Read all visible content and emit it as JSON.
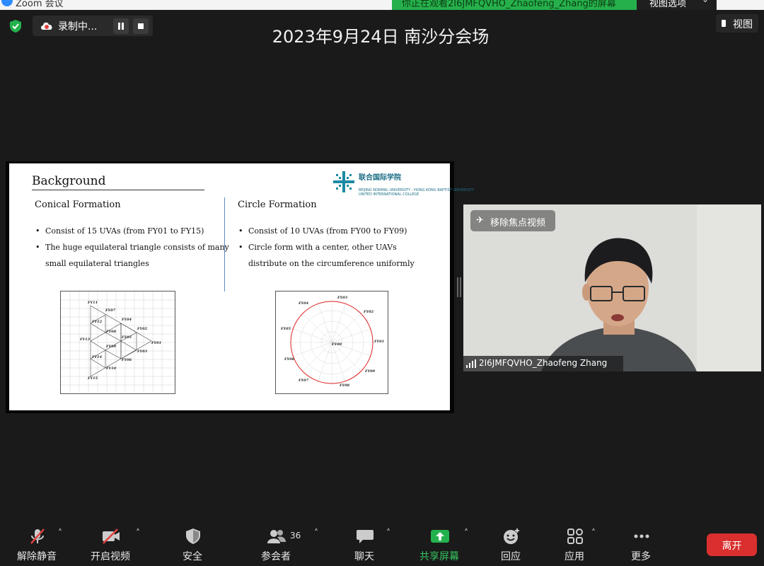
{
  "window": {
    "app_title": "Zoom 会议",
    "share_banner": "你正在观看2I6JMFQVHO_Zhaofeng_Zhang的屏幕",
    "view_options": "视图选项"
  },
  "header": {
    "recording_label": "录制中...",
    "meeting_title": "2023年9月24日 南沙分会场",
    "view_button": "视图"
  },
  "slide": {
    "title": "Background",
    "logo_cn": "联合国际学院",
    "logo_en": "UNITED INTERNATIONAL COLLEGE",
    "logo_en_small": "BEIJING NORMAL UNIVERSITY - HONG KONG BAPTIST UNIVERSITY",
    "left": {
      "subtitle": "Conical Formation",
      "bullet_1": "Consist of 15 UVAs (from FY01 to FY15)",
      "bullet_2a": "The huge equilateral triangle consists of many",
      "bullet_2b": "small equilateral triangles"
    },
    "right": {
      "subtitle": "Circle Formation",
      "bullet_1": "Consist of 10 UVAs (from FY00 to FY09)",
      "bullet_2a": "Circle form with a center, other UAVs",
      "bullet_2b": "distribute on the circumference uniformly"
    },
    "cone_labels": {
      "a": "FY11",
      "b": "FY07",
      "c": "FY12",
      "d": "FY04",
      "e": "FY08",
      "f": "FY02",
      "g": "FY13",
      "h": "FY05",
      "i": "FY01",
      "j": "FY09",
      "k": "FY03",
      "l": "FY14",
      "m": "FY06",
      "n": "FY10",
      "o": "FY15"
    },
    "circle_labels": {
      "c0": "FY00",
      "c1": "FY01",
      "c2": "FY02",
      "c3": "FY03",
      "c4": "FY04",
      "c5": "FY05",
      "c6": "FY06",
      "c7": "FY07",
      "c8": "FY08",
      "c9": "FY09"
    }
  },
  "video": {
    "remove_pin": "移除焦点视频",
    "participant_name": "2I6JMFQVHO_Zhaofeng Zhang"
  },
  "toolbar": {
    "unmute": "解除静音",
    "start_video": "开启视频",
    "security": "安全",
    "participants": "参会者",
    "participants_count": "36",
    "chat": "聊天",
    "share_screen": "共享屏幕",
    "reactions": "回应",
    "apps": "应用",
    "more": "更多",
    "leave": "离开"
  },
  "colors": {
    "share_green": "#26b04b",
    "leave_red": "#d9302f",
    "muted_red": "#e04040"
  }
}
